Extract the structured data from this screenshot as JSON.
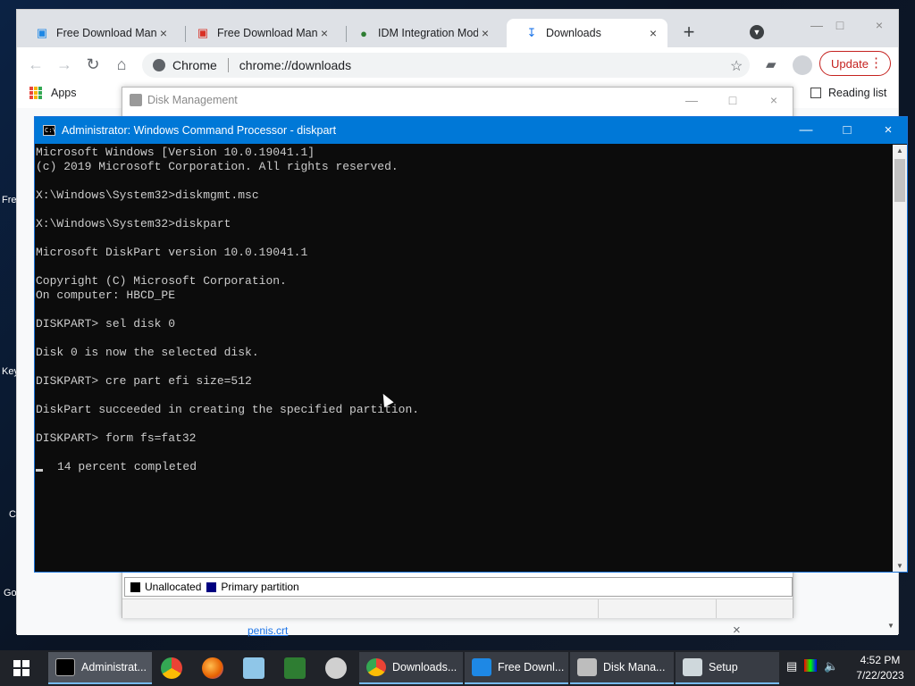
{
  "desktop": {
    "labels": [
      "Fre",
      "Key",
      "C",
      "Go"
    ]
  },
  "chrome": {
    "tabs": [
      {
        "label": "Free Download Mana",
        "icon": "fdm-icon"
      },
      {
        "label": "Free Download Mana",
        "icon": "fdm-icon"
      },
      {
        "label": "IDM Integration Mod",
        "icon": "idm-icon"
      },
      {
        "label": "Downloads",
        "icon": "download-icon"
      }
    ],
    "omnibox": {
      "site": "Chrome",
      "url": "chrome://downloads"
    },
    "update_label": "Update",
    "bookmarks": {
      "apps": "Apps",
      "reading_list": "Reading list"
    },
    "downloads_file": "penis.crt"
  },
  "disk_management": {
    "title": "Disk Management",
    "legend": [
      {
        "label": "Unallocated",
        "color": "#000000"
      },
      {
        "label": "Primary partition",
        "color": "#000080"
      }
    ]
  },
  "cmd": {
    "title": "Administrator: Windows Command Processor - diskpart",
    "lines": [
      "Microsoft Windows [Version 10.0.19041.1]",
      "(c) 2019 Microsoft Corporation. All rights reserved.",
      "",
      "X:\\Windows\\System32>diskmgmt.msc",
      "",
      "X:\\Windows\\System32>diskpart",
      "",
      "Microsoft DiskPart version 10.0.19041.1",
      "",
      "Copyright (C) Microsoft Corporation.",
      "On computer: HBCD_PE",
      "",
      "DISKPART> sel disk 0",
      "",
      "Disk 0 is now the selected disk.",
      "",
      "DISKPART> cre part efi size=512",
      "",
      "DiskPart succeeded in creating the specified partition.",
      "",
      "DISKPART> form fs=fat32",
      ""
    ],
    "progress_text": "14 percent completed",
    "progress_percent": 14
  },
  "taskbar": {
    "items": [
      {
        "label": "Administrat...",
        "active": true
      },
      {
        "label": "Downloads..."
      },
      {
        "label": "Free Downl..."
      },
      {
        "label": "Disk Mana..."
      },
      {
        "label": "Setup"
      }
    ],
    "time": "4:52 PM",
    "date": "7/22/2023"
  },
  "colors": {
    "accent": "#0078d7",
    "update": "#c5221f",
    "console_bg": "#0c0c0c",
    "console_fg": "#cccccc"
  }
}
